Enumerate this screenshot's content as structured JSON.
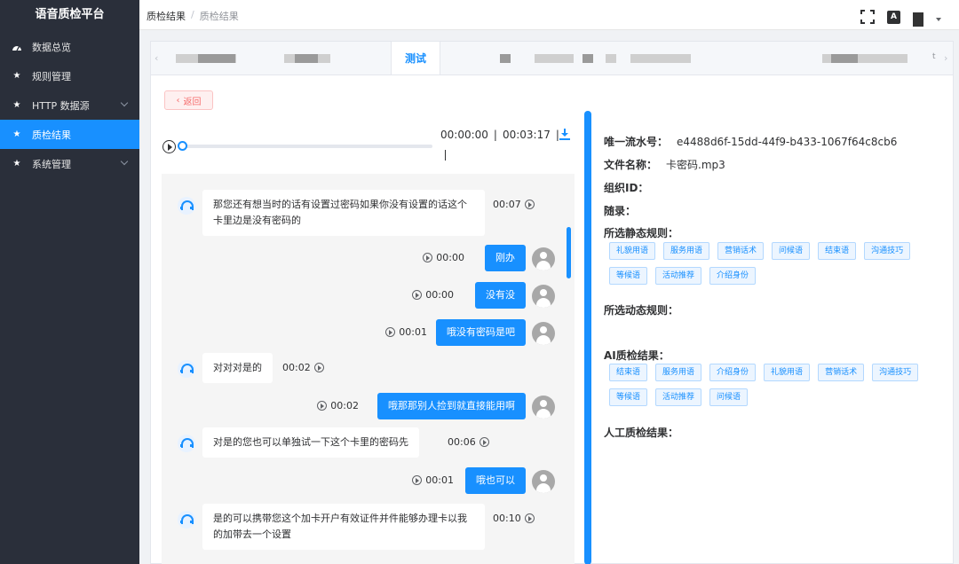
{
  "sidebar": {
    "brand": "语音质检平台",
    "items": [
      {
        "label": "数据总览",
        "icon": "dashboard-icon"
      },
      {
        "label": "规则管理",
        "icon": "star-icon"
      },
      {
        "label": "HTTP 数据源",
        "icon": "star-icon",
        "expandable": true
      },
      {
        "label": "质检结果",
        "icon": "star-icon",
        "active": true
      },
      {
        "label": "系统管理",
        "icon": "star-icon",
        "expandable": true
      }
    ]
  },
  "header": {
    "breadcrumb": [
      "质检结果",
      "质检结果"
    ],
    "lang_icon_text": "A"
  },
  "tabs": {
    "active_label": "测试"
  },
  "back_button": "返回",
  "player": {
    "current": "00:00:00",
    "total": "00:03:17",
    "progress": 0
  },
  "conversation": [
    {
      "role": "agent",
      "text": "那您还有想当时的话有设置过密码如果你没有设置的话这个卡里边是没有密码的",
      "time": "00:07"
    },
    {
      "role": "customer",
      "text": "刚办",
      "time": "00:00"
    },
    {
      "role": "customer",
      "text": "没有没",
      "time": "00:00"
    },
    {
      "role": "customer",
      "text": "哦没有密码是吧",
      "time": "00:01"
    },
    {
      "role": "agent",
      "text": "对对对是的",
      "time": "00:02"
    },
    {
      "role": "customer",
      "text": "哦那那别人捡到就直接能用啊",
      "time": "00:02"
    },
    {
      "role": "agent",
      "text": "对是的您也可以单独试一下这个卡里的密码先",
      "time": "00:06"
    },
    {
      "role": "customer",
      "text": "哦也可以",
      "time": "00:01"
    },
    {
      "role": "agent",
      "text": "是的可以携带您这个加卡开户有效证件并件能够办理卡以我的加带去一个设置",
      "time": "00:10"
    }
  ],
  "details": {
    "serial_label": "唯一流水号：",
    "serial_value": "e4488d6f-15dd-44f9-b433-1067f64c8cb6",
    "filename_label": "文件名称：",
    "filename_value": "卡密码.mp3",
    "org_label": "组织ID：",
    "record_label": "随录：",
    "static_rules_label": "所选静态规则：",
    "static_rules": [
      "礼貌用语",
      "服务用语",
      "营销话术",
      "问候语",
      "结束语",
      "沟通技巧",
      "等候语",
      "活动推荐",
      "介绍身份"
    ],
    "dynamic_rules_label": "所选动态规则：",
    "ai_label": "AI质检结果：",
    "ai_results": [
      "结束语",
      "服务用语",
      "介绍身份",
      "礼貌用语",
      "营销话术",
      "沟通技巧",
      "等候语",
      "活动推荐",
      "问候语"
    ],
    "manual_label": "人工质检结果："
  }
}
